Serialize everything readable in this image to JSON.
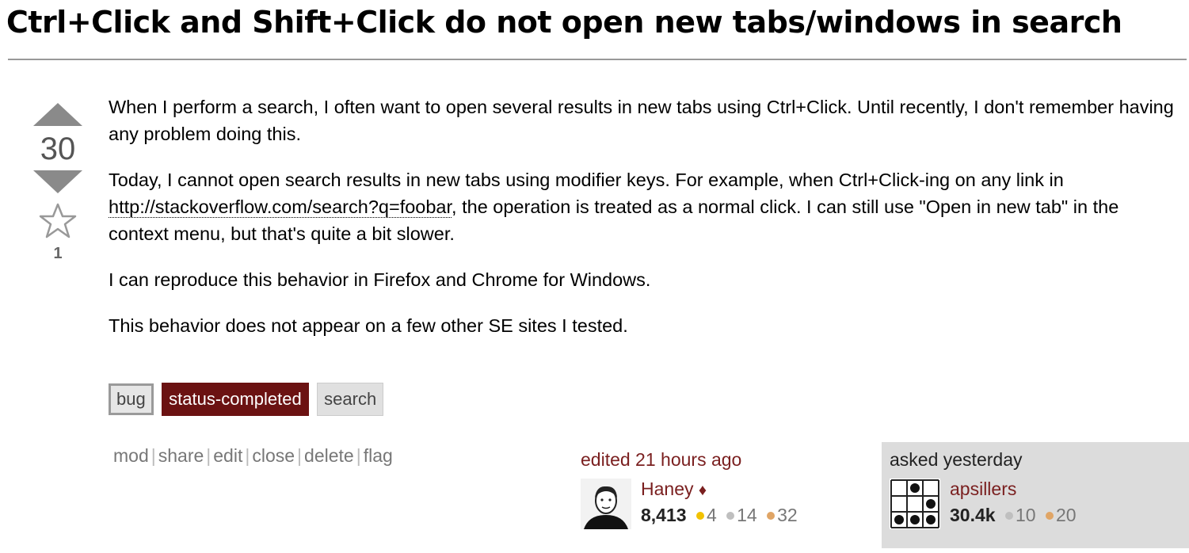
{
  "question": {
    "title": "Ctrl+Click and Shift+Click do not open new tabs/windows in search",
    "score": "30",
    "favorite_count": "1",
    "paragraphs": [
      "When I perform a search, I often want to open several results in new tabs using Ctrl+Click. Until recently, I don't remember having any problem doing this.",
      "I can reproduce this behavior in Firefox and Chrome for Windows.",
      "This behavior does not appear on a few other SE sites I tested."
    ],
    "para2_before": "Today, I cannot open search results in new tabs using modifier keys. For example, when Ctrl+Click-ing on any link in ",
    "para2_link": "http://stackoverflow.com/search?q=foobar",
    "para2_after": ", the operation is treated as a normal click. I can still use \"Open in new tab\" in the context menu, but that's quite a bit slower."
  },
  "tags": [
    "bug",
    "status-completed",
    "search"
  ],
  "actions": [
    "mod",
    "share",
    "edit",
    "close",
    "delete",
    "flag"
  ],
  "action_separator": "|",
  "edited": {
    "label": "edited 21 hours ago",
    "user": "Haney",
    "moderator_mark": "♦",
    "reputation": "8,413",
    "badges": {
      "gold": "4",
      "silver": "14",
      "bronze": "32"
    }
  },
  "asked": {
    "label": "asked yesterday",
    "user": "apsillers",
    "reputation": "30.4k",
    "badges": {
      "silver": "10",
      "bronze": "20"
    }
  },
  "colors": {
    "tag_status_bg": "#6b1212",
    "user_link": "#7a1f1f",
    "owner_bg": "#dcdcdc",
    "gold": "#f2c200",
    "silver": "#bfbfbf",
    "bronze": "#e0a566"
  }
}
